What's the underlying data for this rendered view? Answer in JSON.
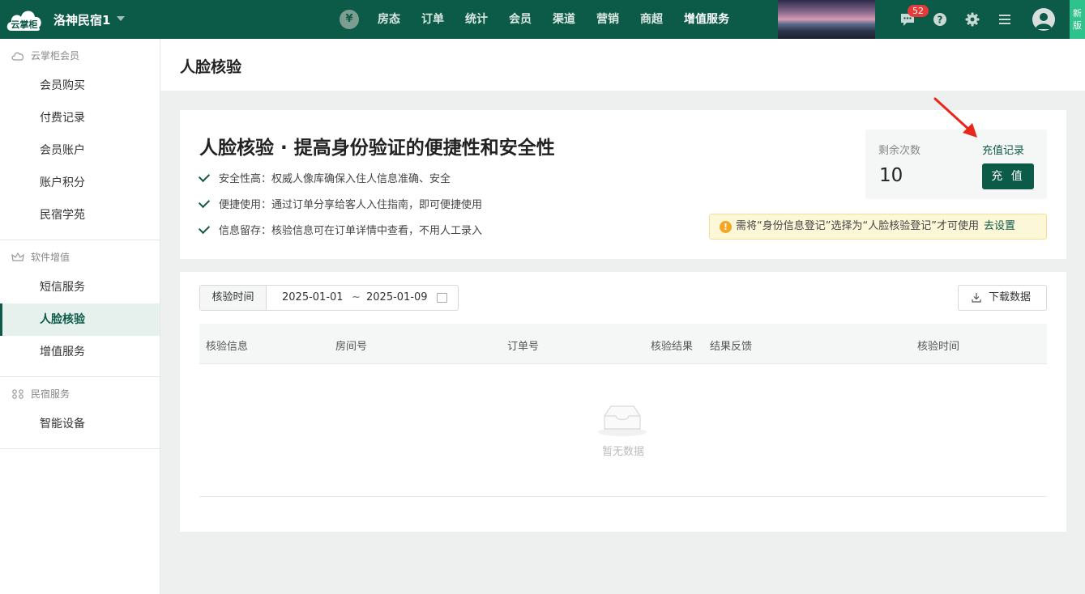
{
  "topbar": {
    "logo_text": "云掌柜",
    "hotel_name": "洛神民宿1",
    "nav_items": [
      "房态",
      "订单",
      "统计",
      "会员",
      "渠道",
      "营销",
      "商超",
      "增值服务"
    ],
    "active_nav": "增值服务",
    "message_badge": "52",
    "new_version": "新版",
    "colors": {
      "bar": "#0c5a48",
      "accent": "#2fc28c",
      "badge": "#e53a3a"
    }
  },
  "sidebar": {
    "groups": [
      {
        "title": "云掌柜会员",
        "icon": "cloud-icon",
        "items": [
          "会员购买",
          "付费记录",
          "会员账户",
          "账户积分",
          "民宿学苑"
        ]
      },
      {
        "title": "软件增值",
        "icon": "crown-icon",
        "items": [
          "短信服务",
          "人脸核验",
          "增值服务"
        ]
      },
      {
        "title": "民宿服务",
        "icon": "grid-icon",
        "items": [
          "智能设备"
        ]
      }
    ],
    "active_item": "人脸核验"
  },
  "page": {
    "title": "人脸核验"
  },
  "intro": {
    "headline": "人脸核验 · 提高身份验证的便捷性和安全性",
    "features": [
      "安全性高：权威人像库确保入住人信息准确、安全",
      "便捷使用：通过订单分享给客人入住指南，即可便捷使用",
      "信息留存：核验信息可在订单详情中查看，不用人工录入"
    ],
    "remaining_label": "剩余次数",
    "remaining_count": "10",
    "recharge_record_link": "充值记录",
    "recharge_button": "充 值",
    "notice_text": "需将“身份信息登记”选择为“人脸核验登记”才可使用",
    "notice_link": "去设置"
  },
  "records": {
    "filter_label": "核验时间",
    "date_start": "2025-01-01",
    "date_separator": "~",
    "date_end": "2025-01-09",
    "download_button": "下载数据",
    "columns": [
      "核验信息",
      "房间号",
      "订单号",
      "核验结果",
      "结果反馈",
      "核验时间"
    ],
    "rows": [],
    "empty_text": "暂无数据"
  }
}
